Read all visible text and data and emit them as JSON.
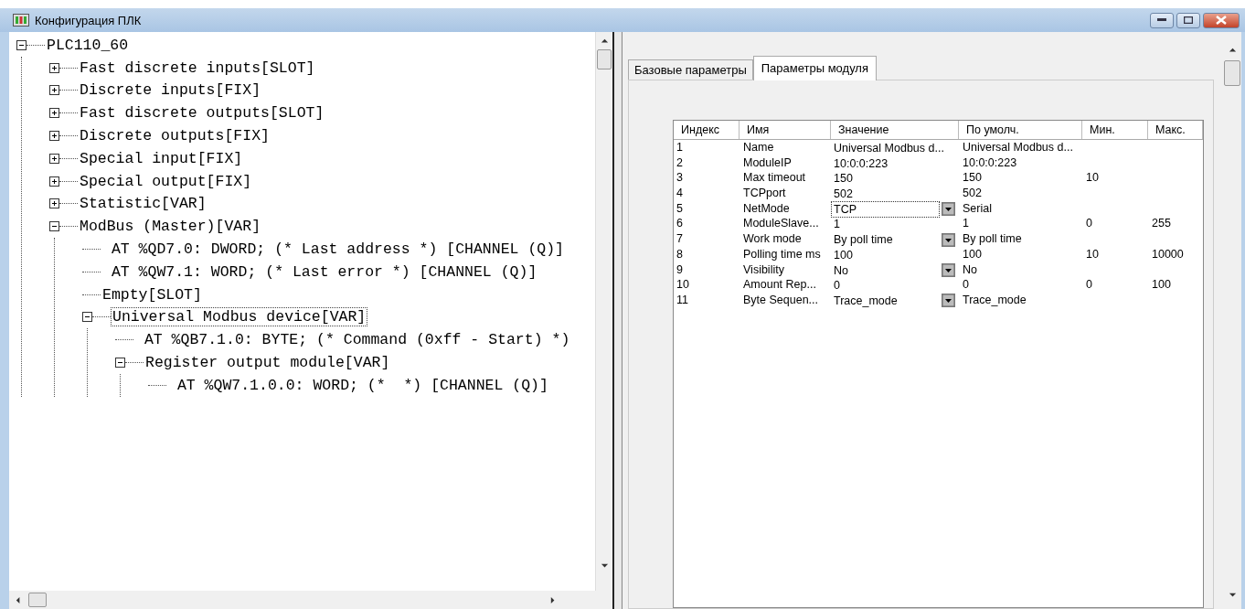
{
  "window": {
    "title": "Конфигурация ПЛК"
  },
  "tree": [
    {
      "label": "PLC110_60",
      "expanded": true,
      "selected": false,
      "children": [
        {
          "label": "Fast discrete inputs[SLOT]",
          "expanded": false,
          "selected": false
        },
        {
          "label": "Discrete inputs[FIX]",
          "expanded": false,
          "selected": false
        },
        {
          "label": "Fast discrete outputs[SLOT]",
          "expanded": false,
          "selected": false
        },
        {
          "label": "Discrete outputs[FIX]",
          "expanded": false,
          "selected": false
        },
        {
          "label": "Special input[FIX]",
          "expanded": false,
          "selected": false
        },
        {
          "label": "Special output[FIX]",
          "expanded": false,
          "selected": false
        },
        {
          "label": "Statistic[VAR]",
          "expanded": false,
          "selected": false
        },
        {
          "label": "ModBus (Master)[VAR]",
          "expanded": true,
          "selected": false,
          "children": [
            {
              "label": " AT %QD7.0: DWORD; (* Last address *) [CHANNEL (Q)]",
              "selected": false
            },
            {
              "label": " AT %QW7.1: WORD; (* Last error *) [CHANNEL (Q)]",
              "selected": false
            },
            {
              "label": "Empty[SLOT]",
              "selected": false
            },
            {
              "label": "Universal Modbus device[VAR]",
              "expanded": true,
              "selected": true,
              "children": [
                {
                  "label": " AT %QB7.1.0: BYTE; (* Command (0xff - Start) *)",
                  "selected": false
                },
                {
                  "label": "Register output module[VAR]",
                  "expanded": true,
                  "selected": false,
                  "children": [
                    {
                      "label": " AT %QW7.1.0.0: WORD; (*  *) [CHANNEL (Q)]",
                      "selected": false
                    }
                  ]
                }
              ]
            }
          ]
        }
      ]
    }
  ],
  "tabs": [
    {
      "label": "Базовые параметры",
      "selected": false
    },
    {
      "label": "Параметры модуля",
      "selected": true
    }
  ],
  "table": {
    "columns": [
      "Индекс",
      "Имя",
      "Значение",
      "По умолч.",
      "Мин.",
      "Макс."
    ],
    "rows": [
      {
        "kind": "text",
        "selected": false,
        "cells": [
          "1",
          "Name",
          "Universal Modbus d...",
          "Universal Modbus d...",
          "",
          ""
        ]
      },
      {
        "kind": "text",
        "selected": false,
        "cells": [
          "2",
          "ModuleIP",
          "10:0:0:223",
          "10:0:0:223",
          "",
          ""
        ]
      },
      {
        "kind": "text",
        "selected": false,
        "cells": [
          "3",
          "Max timeout",
          "150",
          "150",
          "10",
          ""
        ]
      },
      {
        "kind": "text",
        "selected": false,
        "cells": [
          "4",
          "TCPport",
          "502",
          "502",
          "",
          ""
        ]
      },
      {
        "kind": "dropdown",
        "selected": true,
        "cells": [
          "5",
          "NetMode",
          "TCP",
          "Serial",
          "",
          ""
        ]
      },
      {
        "kind": "text",
        "selected": false,
        "cells": [
          "6",
          "ModuleSlave...",
          "1",
          "1",
          "0",
          "255"
        ]
      },
      {
        "kind": "dropdown",
        "selected": false,
        "cells": [
          "7",
          "Work mode",
          "By poll time",
          "By poll time",
          "",
          ""
        ]
      },
      {
        "kind": "text",
        "selected": false,
        "cells": [
          "8",
          "Polling time ms",
          "100",
          "100",
          "10",
          "10000"
        ]
      },
      {
        "kind": "dropdown",
        "selected": false,
        "cells": [
          "9",
          "Visibility",
          "No",
          "No",
          "",
          ""
        ]
      },
      {
        "kind": "text",
        "selected": false,
        "cells": [
          "10",
          "Amount Rep...",
          "0",
          "0",
          "0",
          "100"
        ]
      },
      {
        "kind": "dropdown",
        "selected": false,
        "cells": [
          "11",
          "Byte Sequen...",
          "Trace_mode",
          "Trace_mode",
          "",
          ""
        ]
      }
    ]
  }
}
